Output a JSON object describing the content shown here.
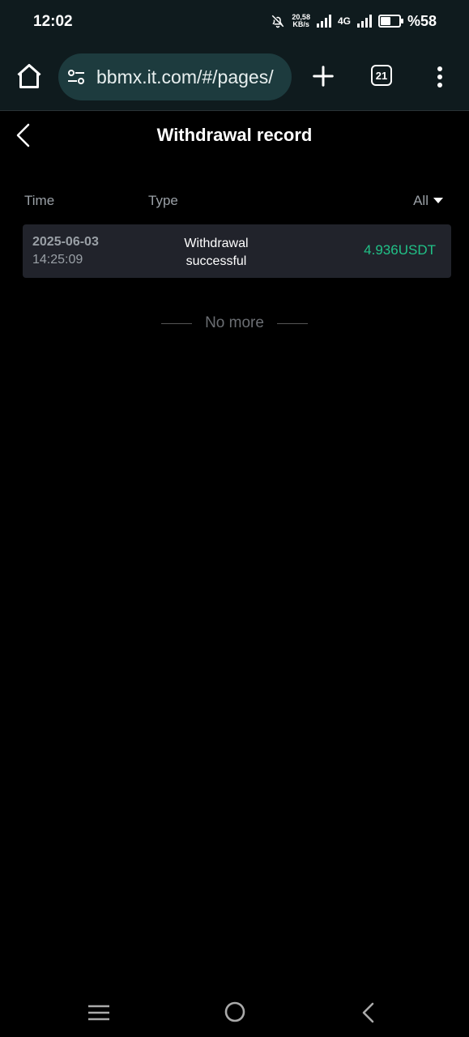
{
  "status_bar": {
    "time": "12:02",
    "speed_value": "20,58",
    "speed_unit": "KB/s",
    "network": "4G",
    "battery_pct": "%58",
    "battery_level": 0.58
  },
  "browser": {
    "url": "bbmx.it.com/#/pages/",
    "tab_count": "21"
  },
  "page": {
    "title": "Withdrawal record"
  },
  "columns": {
    "time": "Time",
    "type": "Type",
    "filter": "All"
  },
  "records": [
    {
      "date": "2025-06-03",
      "time": "14:25:09",
      "type": "Withdrawal successful",
      "amount": "4.936USDT"
    }
  ],
  "list_end_text": "No more",
  "colors": {
    "accent_green": "#21c187",
    "chrome_bg": "#0f1b1e",
    "urlbar_bg": "#1d3b3e",
    "record_bg": "#21232b"
  },
  "icons": {
    "status": [
      "bell-off-icon",
      "signal-icon",
      "battery-icon"
    ],
    "browser": [
      "home-icon",
      "tune-icon",
      "plus-icon",
      "tabs-icon",
      "more-vert-icon"
    ],
    "nav": [
      "nav-menu-icon",
      "nav-home-icon",
      "nav-back-icon"
    ]
  }
}
